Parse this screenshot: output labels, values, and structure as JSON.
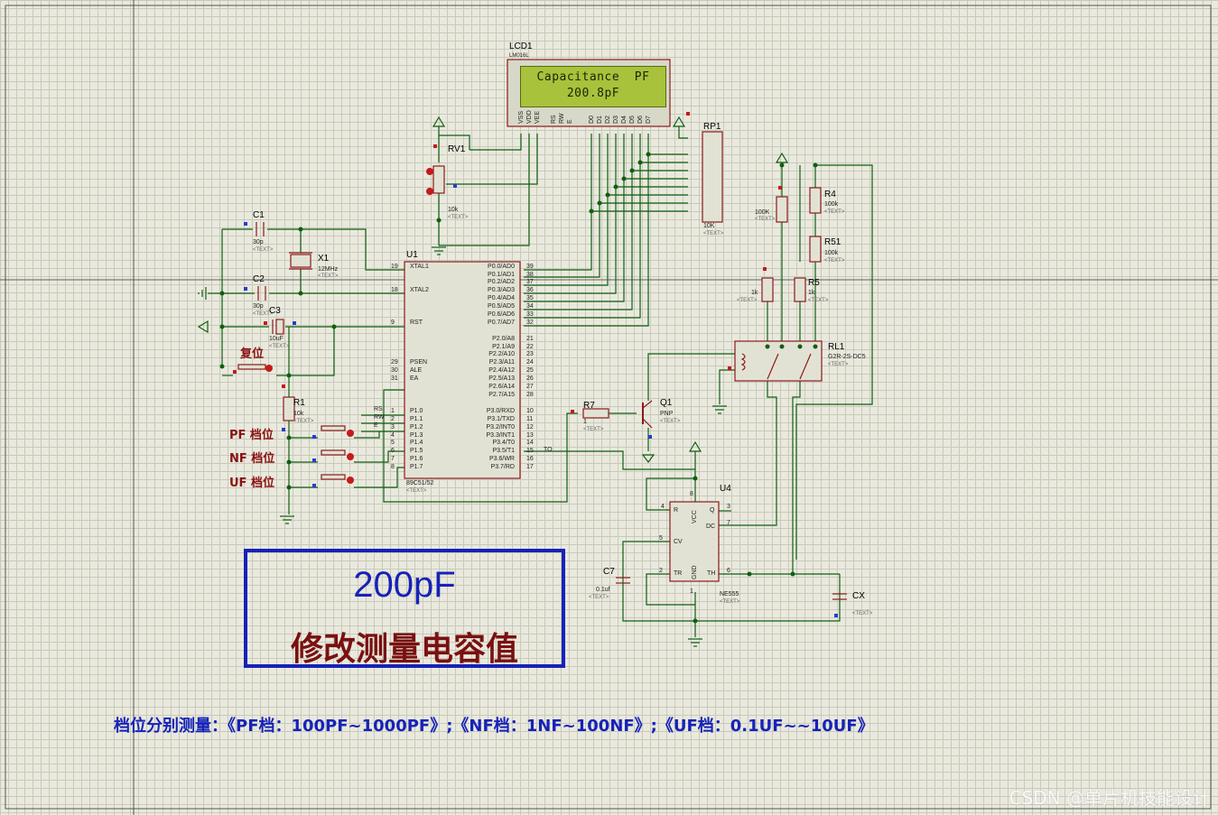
{
  "lcd": {
    "ref": "LCD1",
    "part": "LM016L",
    "line1": "Capacitance  PF",
    "line2": "200.8pF",
    "pins": [
      "VSS",
      "VDD",
      "VEE",
      "RS",
      "RW",
      "E",
      "D0",
      "D1",
      "D2",
      "D3",
      "D4",
      "D5",
      "D6",
      "D7"
    ]
  },
  "components": {
    "rv1": {
      "ref": "RV1",
      "value": "10k"
    },
    "c1": {
      "ref": "C1",
      "value": "30p"
    },
    "c2": {
      "ref": "C2",
      "value": "30p"
    },
    "c3": {
      "ref": "C3",
      "value": "10uF"
    },
    "x1": {
      "ref": "X1",
      "value": "12MHz"
    },
    "u1": {
      "ref": "U1",
      "part": "89C51/52"
    },
    "r1": {
      "ref": "R1",
      "value": "10k"
    },
    "rp1": {
      "ref": "RP1",
      "value": "10K"
    },
    "r4": {
      "ref": "R4",
      "value": "100k"
    },
    "r51": {
      "ref": "R51",
      "value": "100k"
    },
    "r5": {
      "ref": "R5",
      "value": "1k"
    },
    "rl1": {
      "ref": "RL1",
      "part": "G2R-2S-DC5"
    },
    "r7": {
      "ref": "R7",
      "value": "1"
    },
    "q1": {
      "ref": "Q1",
      "part": "PNP"
    },
    "u4": {
      "ref": "U4",
      "part": "NE555"
    },
    "c7": {
      "ref": "C7",
      "value": "0.1uf"
    },
    "cx": {
      "ref": "CX"
    },
    "r100k": {
      "value": "100K"
    },
    "r1k": {
      "value": "1k"
    }
  },
  "text_placeholder": "<TEXT>",
  "u1_left_pins": [
    {
      "num": "19",
      "name": "XTAL1"
    },
    {
      "num": "18",
      "name": "XTAL2"
    },
    {
      "num": "9",
      "name": "RST"
    },
    {
      "num": "29",
      "name": "PSEN"
    },
    {
      "num": "30",
      "name": "ALE"
    },
    {
      "num": "31",
      "name": "EA"
    },
    {
      "num": "1",
      "name": "P1.0"
    },
    {
      "num": "2",
      "name": "P1.1"
    },
    {
      "num": "3",
      "name": "P1.2"
    },
    {
      "num": "4",
      "name": "P1.3"
    },
    {
      "num": "5",
      "name": "P1.4"
    },
    {
      "num": "6",
      "name": "P1.5"
    },
    {
      "num": "7",
      "name": "P1.6"
    },
    {
      "num": "8",
      "name": "P1.7"
    }
  ],
  "u1_right_pins": [
    {
      "num": "39",
      "name": "P0.0/AD0"
    },
    {
      "num": "38",
      "name": "P0.1/AD1"
    },
    {
      "num": "37",
      "name": "P0.2/AD2"
    },
    {
      "num": "36",
      "name": "P0.3/AD3"
    },
    {
      "num": "35",
      "name": "P0.4/AD4"
    },
    {
      "num": "34",
      "name": "P0.5/AD5"
    },
    {
      "num": "33",
      "name": "P0.6/AD6"
    },
    {
      "num": "32",
      "name": "P0.7/AD7"
    },
    {
      "num": "21",
      "name": "P2.0/A8"
    },
    {
      "num": "22",
      "name": "P2.1/A9"
    },
    {
      "num": "23",
      "name": "P2.2/A10"
    },
    {
      "num": "24",
      "name": "P2.3/A11"
    },
    {
      "num": "25",
      "name": "P2.4/A12"
    },
    {
      "num": "26",
      "name": "P2.5/A13"
    },
    {
      "num": "27",
      "name": "P2.6/A14"
    },
    {
      "num": "28",
      "name": "P2.7/A15"
    },
    {
      "num": "10",
      "name": "P3.0/RXD"
    },
    {
      "num": "11",
      "name": "P3.1/TXD"
    },
    {
      "num": "12",
      "name": "P3.2/INT0"
    },
    {
      "num": "13",
      "name": "P3.3/INT1"
    },
    {
      "num": "14",
      "name": "P3.4/T0"
    },
    {
      "num": "15",
      "name": "P3.5/T1"
    },
    {
      "num": "16",
      "name": "P3.6/WR"
    },
    {
      "num": "17",
      "name": "P3.7/RD"
    }
  ],
  "net_labels": {
    "rs": "RS",
    "rw": "RW",
    "e": "E",
    "to": "TO"
  },
  "u4_pins": {
    "r": "R",
    "vcc": "VCC",
    "q": "Q",
    "dc": "DC",
    "cv": "CV",
    "tr": "TR",
    "gnd": "GND",
    "th": "TH",
    "n4": "4",
    "n8": "8",
    "n3": "3",
    "n7": "7",
    "n5": "5",
    "n2": "2",
    "n1": "1",
    "n6": "6"
  },
  "buttons": {
    "reset": "复位",
    "pf": "PF 档位",
    "nf": "NF 档位",
    "uf": "UF 档位"
  },
  "info_box": {
    "value": "200pF",
    "desc": "修改测量电容值"
  },
  "range_note": "档位分别测量：《PF档：100PF~1000PF》;《NF档：1NF~100NF》;《UF档：0.1UF~~10UF》",
  "watermark": "CSDN @单片机技能设计",
  "colors": {
    "wire": "#0f5f0f",
    "part": "#8b1a1a",
    "info_blue": "#1622b8",
    "info_red": "#7a1010",
    "lcd_green": "#a8c23c"
  }
}
